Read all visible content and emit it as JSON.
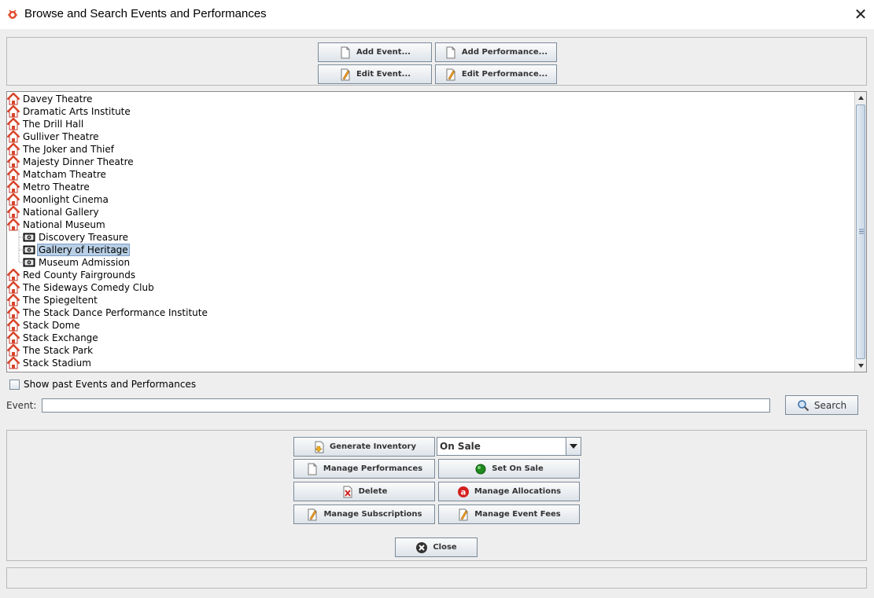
{
  "window": {
    "title": "Browse and Search Events and Performances",
    "icon": "app-bug-icon",
    "close_glyph": "✕"
  },
  "toolbar": {
    "add_event": "Add Event...",
    "add_performance": "Add Performance...",
    "edit_event": "Edit Event...",
    "edit_performance": "Edit Performance..."
  },
  "tree": {
    "items": [
      {
        "label": "Davey Theatre",
        "type": "venue"
      },
      {
        "label": "Dramatic Arts Institute",
        "type": "venue"
      },
      {
        "label": "The Drill Hall",
        "type": "venue"
      },
      {
        "label": "Gulliver Theatre",
        "type": "venue"
      },
      {
        "label": "The Joker and Thief",
        "type": "venue"
      },
      {
        "label": "Majesty Dinner Theatre",
        "type": "venue"
      },
      {
        "label": "Matcham Theatre",
        "type": "venue"
      },
      {
        "label": "Metro Theatre",
        "type": "venue"
      },
      {
        "label": "Moonlight Cinema",
        "type": "venue"
      },
      {
        "label": "National Gallery",
        "type": "venue"
      },
      {
        "label": "National Museum",
        "type": "venue"
      },
      {
        "label": "Discovery Treasure",
        "type": "event"
      },
      {
        "label": "Gallery of Heritage",
        "type": "event",
        "selected": true
      },
      {
        "label": "Museum Admission",
        "type": "event"
      },
      {
        "label": "Red County Fairgrounds",
        "type": "venue"
      },
      {
        "label": "The Sideways Comedy Club",
        "type": "venue"
      },
      {
        "label": "The Spiegeltent",
        "type": "venue"
      },
      {
        "label": "The Stack Dance Performance Institute",
        "type": "venue"
      },
      {
        "label": "Stack Dome",
        "type": "venue"
      },
      {
        "label": "Stack Exchange",
        "type": "venue"
      },
      {
        "label": "The Stack Park",
        "type": "venue"
      },
      {
        "label": "Stack Stadium",
        "type": "venue"
      }
    ]
  },
  "filters": {
    "show_past_label": "Show past Events and Performances",
    "show_past_checked": false,
    "event_label": "Event:",
    "event_value": "",
    "search_button": "Search"
  },
  "actions": {
    "generate_inventory": "Generate Inventory",
    "status_selected": "On Sale",
    "manage_performances": "Manage Performances",
    "set_on_sale": "Set On Sale",
    "delete": "Delete",
    "manage_allocations": "Manage Allocations",
    "manage_subscriptions": "Manage Subscriptions",
    "manage_event_fees": "Manage Event Fees",
    "close": "Close"
  },
  "colors": {
    "selection_bg": "#b8cfe5",
    "on_sale_dot": "#1f8a1f",
    "allocations_icon": "#d42020",
    "venue_roof": "#d8452a"
  }
}
